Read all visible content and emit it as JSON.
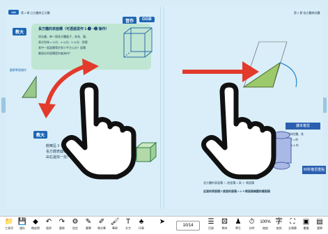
{
  "page_left": {
    "page_badge": "146",
    "chapter_header": "第 2 章  立方體與正方體",
    "problem_button": "習作",
    "ggb_button": "GGB",
    "teach_chip": "教大",
    "question_number": "2",
    "question_title": "長方體的表面積（可透過習作 1-❶ ~❸ 操作）",
    "question_lines": [
      "如右圖，每一個長方體盒子，其長、寬、",
      "高分別為 x 公分、a 公分、b 公分，那麼",
      "其中一面面積等於多少平方公分？面積",
      "最接近的面積是何者為何？"
    ],
    "figure_caption": "觀察學習操作",
    "lower_chip": "教大",
    "lower_lines": [
      "觀察區 3 · 計算並分享出",
      "長方體表面積",
      "由右邊找一找？"
    ]
  },
  "page_right": {
    "header": "第 2 節  長方體與柱體",
    "side_chip": "課本複習",
    "formula_chip": "90秒複習重點",
    "lines": [
      "表面積為多少的長方體與柱體，其",
      "若要把展開圖所需的數字 x 的",
      "一面積為多大，請問比為 A 的",
      "長方體的表面積 ＝ 底面積 × 高 ＋ 側面積"
    ],
    "summary": "此面的表面積＝底面的面積 × 2 ＋側面展開圖的總面積"
  },
  "toolbar": {
    "left_tools": [
      {
        "icon": "folder-icon",
        "glyph": "📁",
        "label": "工具列"
      },
      {
        "icon": "save-icon",
        "glyph": "💾",
        "label": "儲存"
      },
      {
        "icon": "eraser-icon",
        "glyph": "◆",
        "label": "橡皮擦"
      },
      {
        "icon": "undo-icon",
        "glyph": "↶",
        "label": "復原"
      },
      {
        "icon": "redo-icon",
        "glyph": "↷",
        "label": "重做"
      },
      {
        "icon": "gear-icon",
        "glyph": "⚙",
        "label": "設定"
      },
      {
        "icon": "pen-icon",
        "glyph": "✎",
        "label": "畫筆"
      },
      {
        "icon": "marker-icon",
        "glyph": "✐",
        "label": "螢光筆"
      },
      {
        "icon": "brush-icon",
        "glyph": "🖌",
        "label": "筆刷"
      },
      {
        "icon": "text-icon",
        "glyph": "T",
        "label": "文字"
      },
      {
        "icon": "stamp-icon",
        "glyph": "♣",
        "label": "印章"
      }
    ],
    "cursor_icon": "cursor-icon",
    "page_indicator": "10/14",
    "right_tools": [
      {
        "icon": "list-icon",
        "glyph": "☰",
        "label": "目錄"
      },
      {
        "icon": "folder-icon",
        "glyph": "⚄",
        "label": "教材"
      },
      {
        "icon": "people-icon",
        "glyph": "♟",
        "label": "學生"
      },
      {
        "icon": "timer-icon",
        "glyph": "⏱",
        "label": "計時"
      },
      {
        "icon": "zoom-icon",
        "glyph": "100%",
        "label": "縮放"
      },
      {
        "icon": "dictionary-icon",
        "glyph": "字",
        "label": "查詢"
      },
      {
        "icon": "fullscreen-icon",
        "glyph": "⛶",
        "label": "全螢幕"
      },
      {
        "icon": "chart-icon",
        "glyph": "▣",
        "label": "書籤"
      },
      {
        "icon": "menu-icon",
        "glyph": "▤",
        "label": "選單"
      }
    ]
  },
  "colors": {
    "arrow_red": "#e23a2b",
    "hand_black": "#111111",
    "accent_blue": "#1e66b4",
    "question_green": "#bfe6d3"
  }
}
